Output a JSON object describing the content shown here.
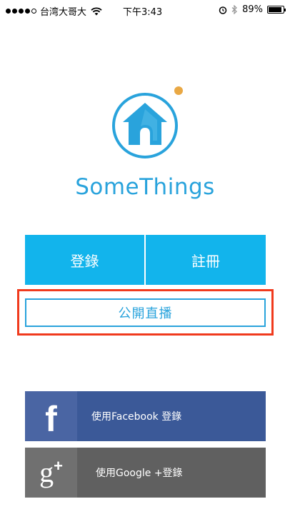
{
  "status_bar": {
    "carrier": "台湾大哥大",
    "time": "下午3:43",
    "battery": "89%",
    "battery_level": 0.89,
    "signal_bars": 4,
    "icons": [
      "wifi-icon",
      "alarm-icon",
      "bluetooth-icon",
      "battery-icon"
    ]
  },
  "brand": {
    "name": "SomeThings",
    "color": "#29a3dc",
    "dot_color": "#e9a844",
    "logo_icon": "house-icon"
  },
  "auth": {
    "login_label": "登錄",
    "register_label": "註冊",
    "button_color": "#12b4ec"
  },
  "live": {
    "label": "公開直播",
    "highlight_color": "#f03a1d"
  },
  "social": {
    "facebook_label": "使用Facebook 登錄",
    "facebook_icon": "facebook-icon",
    "facebook_color": "#3b5998",
    "google_label": "使用Google +登錄",
    "google_icon": "google-plus-icon",
    "google_color": "#606060"
  }
}
